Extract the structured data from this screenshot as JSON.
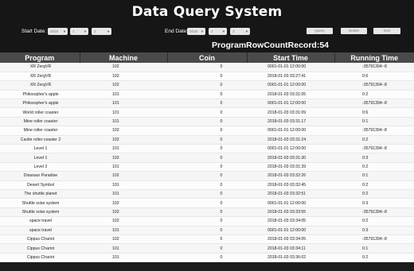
{
  "title": "Data Query System",
  "filters": {
    "start_label": "Start Date:",
    "end_label": "End Date:",
    "start_year": "2018",
    "start_month": "1",
    "start_day": "2",
    "end_year": "2018",
    "end_month": "1",
    "end_day": "3",
    "query_label": "Query",
    "delete_label": "Delete",
    "exit_label": "Exit"
  },
  "record_count": "ProgramRowCountRecord:54",
  "table": {
    "headers": [
      "Program",
      "Machine",
      "Coin",
      "Start Time",
      "Running Time"
    ],
    "rows": [
      [
        "XR ZergVR",
        "102",
        "0",
        "0001-01-01 12:00:00",
        "-35791394:-8"
      ],
      [
        "XR ZergVR",
        "102",
        "0",
        "2018-01-03 03:27:41",
        "0:6"
      ],
      [
        "XR ZergVR",
        "102",
        "0",
        "0001-01-01 12:00:00",
        "-35791394:-8"
      ],
      [
        "Philosopher's apple",
        "101",
        "0",
        "2018-01-03 03:31:05",
        "0:2"
      ],
      [
        "Philosopher's apple",
        "101",
        "0",
        "0001-01-01 12:00:00",
        "-35791394:-8"
      ],
      [
        "World roller coaster",
        "101",
        "0",
        "2018-01-03 03:31:09",
        "0:6"
      ],
      [
        "Mine roller coaster",
        "101",
        "0",
        "2018-01-03 03:31:17",
        "0:1"
      ],
      [
        "Mine roller coaster",
        "102",
        "0",
        "0001-01-01 12:00:00",
        "-35791394:-8"
      ],
      [
        "Castle roller coaster 2",
        "102",
        "0",
        "2018-01-03 03:31:24",
        "0:2"
      ],
      [
        "Level 1",
        "101",
        "0",
        "0001-01-01 12:00:00",
        "-35791394:-8"
      ],
      [
        "Level 1",
        "102",
        "0",
        "2018-01-03 03:31:30",
        "0:3"
      ],
      [
        "Level 2",
        "101",
        "0",
        "2018-01-03 03:31:39",
        "0:2"
      ],
      [
        "Disasaur Paradise",
        "102",
        "0",
        "2018-01-03 03:32:26",
        "0:1"
      ],
      [
        "Desert Symbol",
        "101",
        "0",
        "2018-01-03 03:32:45",
        "0:2"
      ],
      [
        "The shuttle planet",
        "101",
        "0",
        "2018-01-03 03:32:51",
        "0:2"
      ],
      [
        "Shuttle solar system",
        "102",
        "0",
        "0001-01-01 12:00:00",
        "0:3"
      ],
      [
        "Shuttle solar system",
        "102",
        "0",
        "2018-01-03 03:33:55",
        "-35791394:-8"
      ],
      [
        "space travel",
        "102",
        "0",
        "2018-01-03 03:34:05",
        "0:2"
      ],
      [
        "space travel",
        "101",
        "0",
        "0001-01-01 12:00:00",
        "0:3"
      ],
      [
        "Cippus Chariot",
        "102",
        "0",
        "2018-01-03 03:34:05",
        "-35791394:-8"
      ],
      [
        "Cippus Chariot",
        "101",
        "0",
        "2018-01-03 03:34:11",
        "0:1"
      ],
      [
        "Cippus Chariot",
        "101",
        "0",
        "2018-01-03 03:36:02",
        "0:2"
      ]
    ]
  },
  "colors": {
    "background": "#161616",
    "header_row": "#4a4a4a",
    "table_row": "#f6f6f6",
    "control": "#e6e6e6"
  },
  "icons": {
    "dropdown": "chevron-down-icon"
  }
}
